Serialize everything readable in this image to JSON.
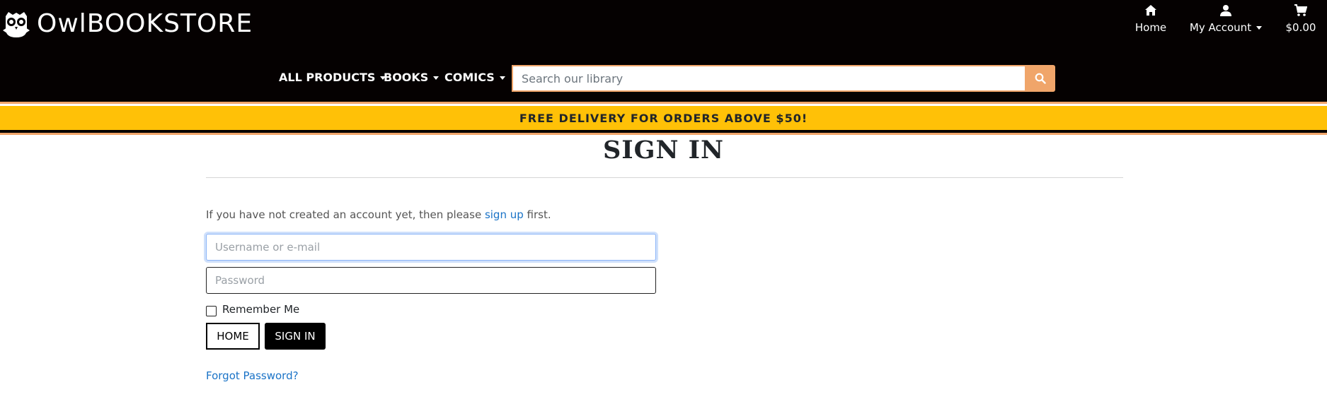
{
  "header": {
    "logo_text": "OwlBOOKSTORE",
    "top_nav": {
      "home_label": "Home",
      "account_label": "My Account",
      "cart_total": "$0.00"
    },
    "categories": {
      "all_products": "ALL PRODUCTS",
      "books": "BOOKS",
      "comics": "COMICS"
    },
    "search": {
      "placeholder": "Search our library"
    }
  },
  "banner": {
    "text": "FREE DELIVERY FOR ORDERS ABOVE $50!"
  },
  "main": {
    "title": "SIGN IN",
    "intro_before": "If you have not created an account yet, then please ",
    "intro_link": "sign up",
    "intro_after": " first.",
    "username_placeholder": "Username or e-mail",
    "password_placeholder": "Password",
    "remember_label": "Remember Me",
    "home_button": "HOME",
    "signin_button": "SIGN IN",
    "forgot_link": "Forgot Password?"
  },
  "colors": {
    "header_bg": "#050101",
    "accent_orange": "#f0a56a",
    "banner_yellow": "#ffc107",
    "link_blue": "#1a73c7"
  }
}
